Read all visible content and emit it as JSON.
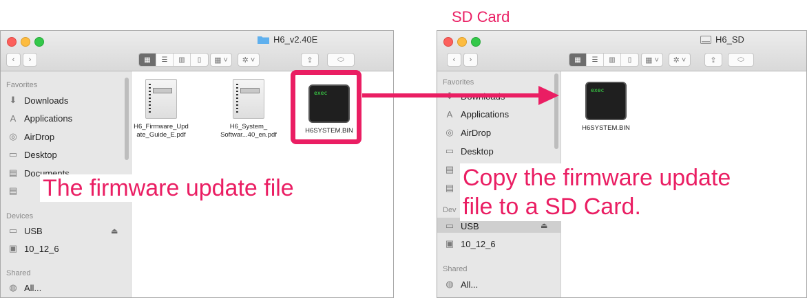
{
  "colors": {
    "accent": "#ea1e63",
    "exec_text": "#3ce24a",
    "sidebar_bg": "#e7e7e7"
  },
  "sd_label": "SD Card",
  "annotation_left": "The firmware update file",
  "annotation_right": [
    "Copy the firmware update",
    "file to a SD Card."
  ],
  "window_left": {
    "title": "H6_v2.40E",
    "favorites_header": "Favorites",
    "favorites": [
      "Downloads",
      "Applications",
      "AirDrop",
      "Desktop",
      "Documents"
    ],
    "devices_header": "Devices",
    "devices": [
      "USB",
      "10_12_6"
    ],
    "shared_header": "Shared",
    "shared": [
      "All..."
    ],
    "files": [
      {
        "name": "H6_Firmware_Upd\nate_Guide_E.pdf",
        "icon": "pdf-document-icon"
      },
      {
        "name": "H6_System_\nSoftwar...40_en.pdf",
        "icon": "pdf-document-icon"
      },
      {
        "name": "H6SYSTEM.BIN",
        "icon": "exec-terminal-icon",
        "icon_text": "exec"
      }
    ]
  },
  "window_right": {
    "title": "H6_SD",
    "favorites_header": "Favorites",
    "favorites": [
      "Downloads",
      "Applications",
      "AirDrop",
      "Desktop"
    ],
    "devices_header": "Dev",
    "devices": [
      "USB",
      "10_12_6"
    ],
    "shared_header": "Shared",
    "shared": [
      "All..."
    ],
    "files": [
      {
        "name": "H6SYSTEM.BIN",
        "icon": "exec-terminal-icon",
        "icon_text": "exec"
      }
    ]
  }
}
